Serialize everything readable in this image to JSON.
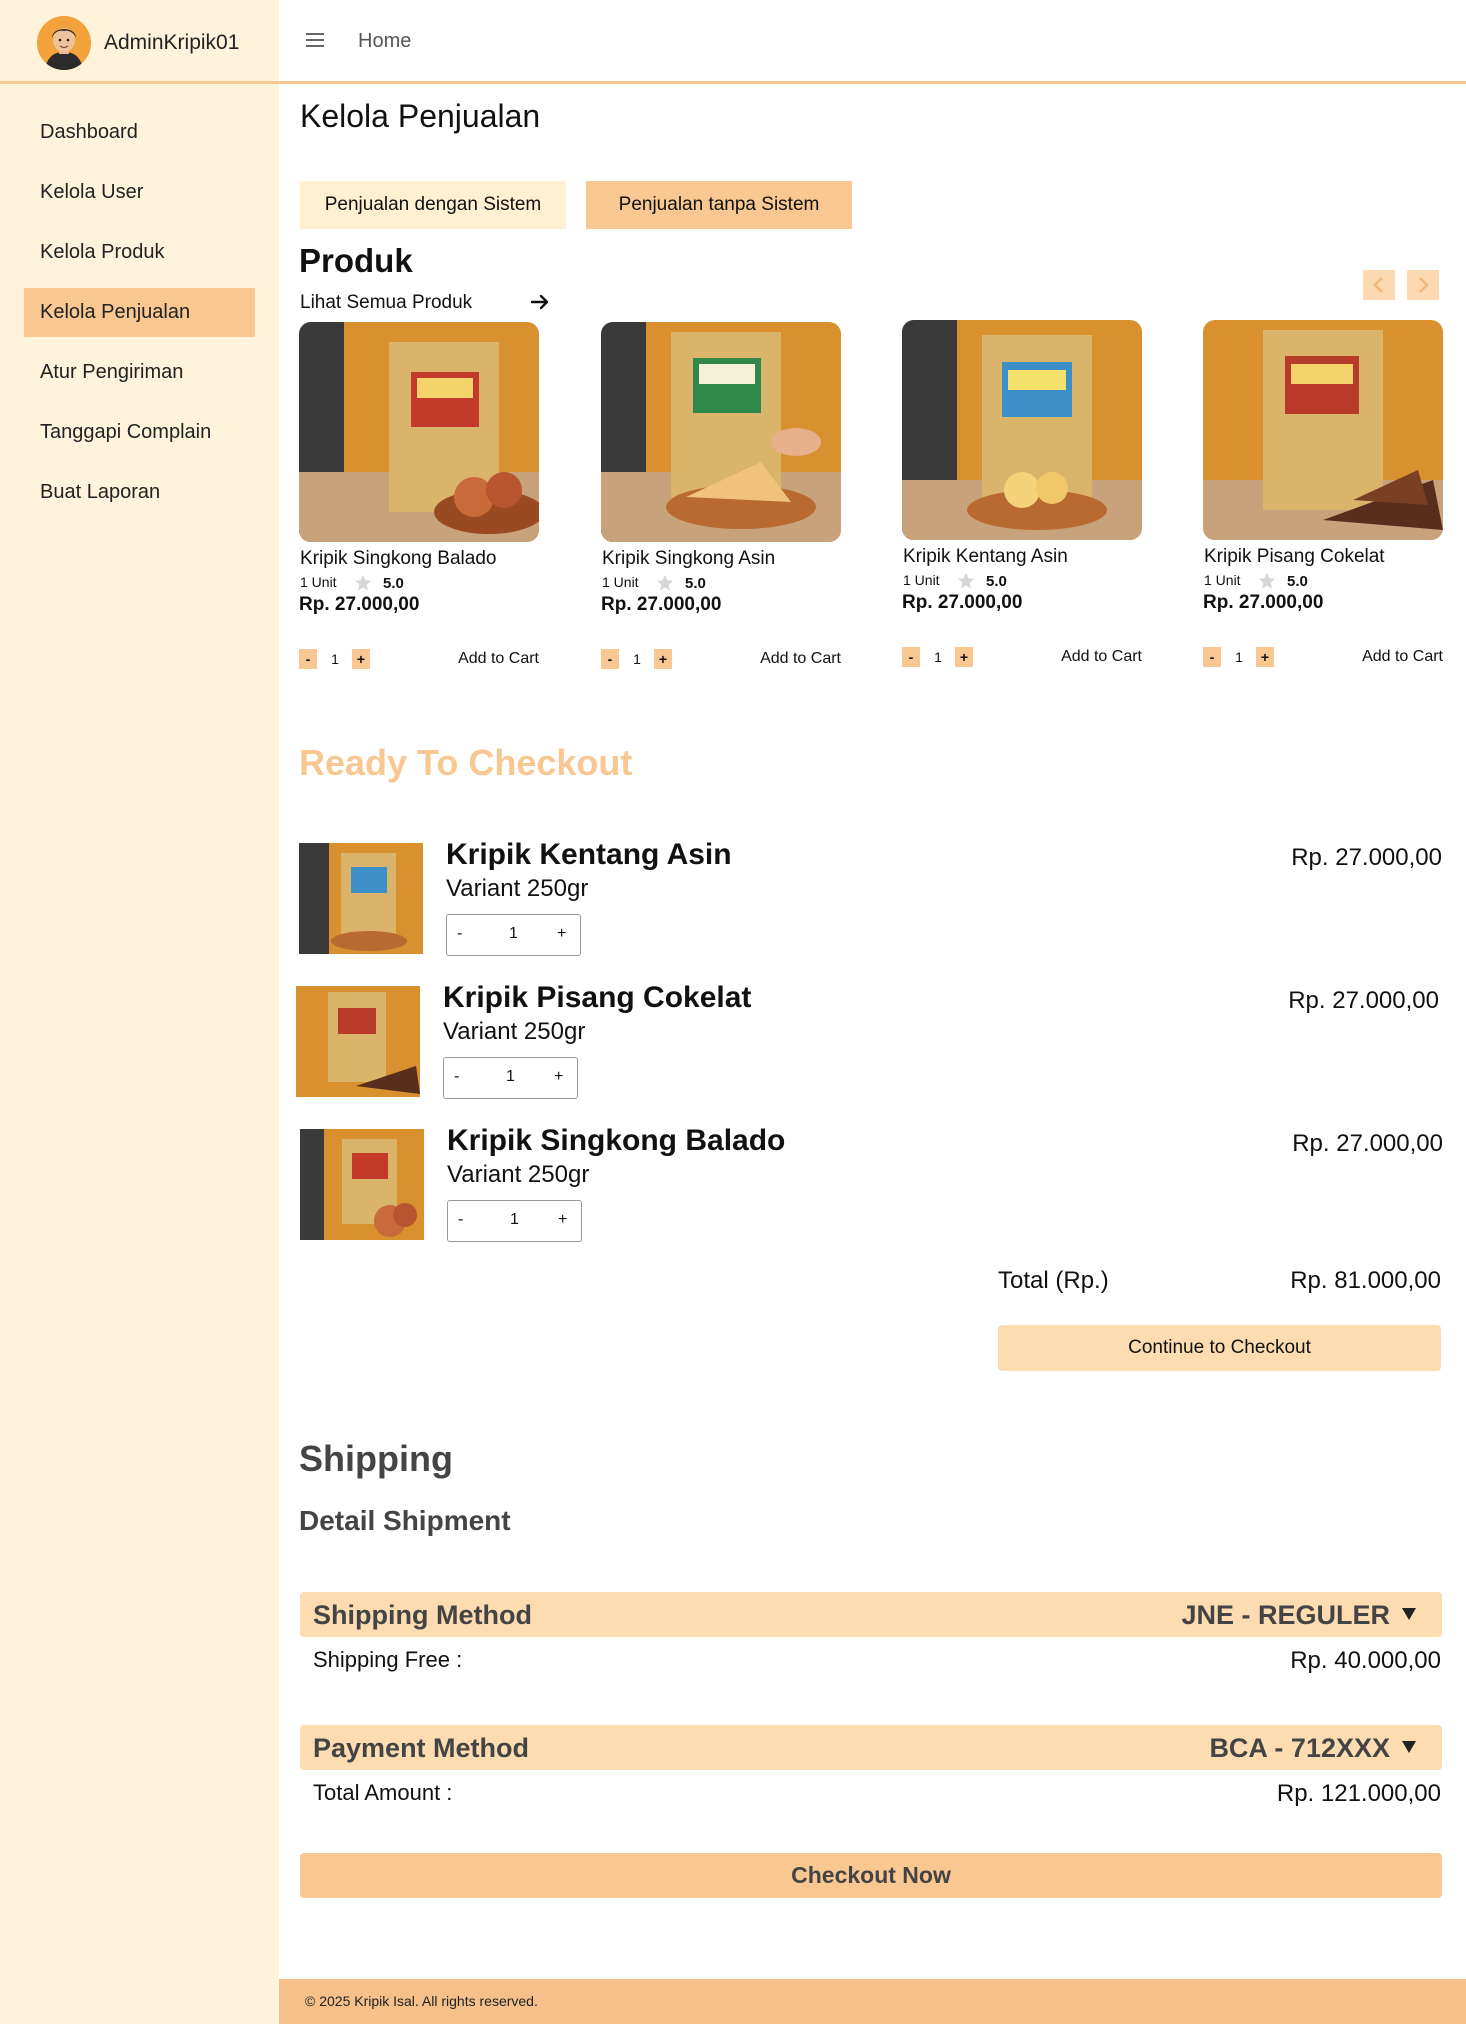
{
  "sidebar": {
    "username": "AdminKripik01",
    "items": [
      {
        "label": "Dashboard"
      },
      {
        "label": "Kelola User"
      },
      {
        "label": "Kelola Produk"
      },
      {
        "label": "Kelola Penjualan",
        "active": true
      },
      {
        "label": "Atur Pengiriman"
      },
      {
        "label": "Tanggapi Complain"
      },
      {
        "label": "Buat Laporan"
      }
    ]
  },
  "header": {
    "breadcrumb": "Home"
  },
  "page_title": "Kelola Penjualan",
  "tabs": [
    {
      "label": "Penjualan dengan Sistem"
    },
    {
      "label": "Penjualan tanpa Sistem",
      "active": true
    }
  ],
  "products_section": {
    "title": "Produk",
    "view_all": "Lihat Semua Produk",
    "items": [
      {
        "name": "Kripik  Singkong Balado",
        "unit": "1 Unit",
        "rating": "5.0",
        "price": "Rp. 27.000,00",
        "qty": "1",
        "add_label": "Add to Cart",
        "minus": "-",
        "plus": "+"
      },
      {
        "name": "Kripik  Singkong Asin",
        "unit": "1 Unit",
        "rating": "5.0",
        "price": "Rp. 27.000,00",
        "qty": "1",
        "add_label": "Add to Cart",
        "minus": "-",
        "plus": "+"
      },
      {
        "name": "Kripik  Kentang Asin",
        "unit": "1 Unit",
        "rating": "5.0",
        "price": "Rp. 27.000,00",
        "qty": "1",
        "add_label": "Add to Cart",
        "minus": "-",
        "plus": "+"
      },
      {
        "name": "Kripik  Pisang Cokelat",
        "unit": "1 Unit",
        "rating": "5.0",
        "price": "Rp. 27.000,00",
        "qty": "1",
        "add_label": "Add to Cart",
        "minus": "-",
        "plus": "+"
      }
    ]
  },
  "checkout": {
    "title": "Ready To Checkout",
    "items": [
      {
        "name": "Kripik  Kentang Asin",
        "variant": "Variant 250gr",
        "qty": "1",
        "price": "Rp. 27.000,00",
        "minus": "-",
        "plus": "+"
      },
      {
        "name": "Kripik Pisang Cokelat",
        "variant": "Variant 250gr",
        "qty": "1",
        "price": "Rp. 27.000,00",
        "minus": "-",
        "plus": "+"
      },
      {
        "name": "Kripik Singkong Balado",
        "variant": "Variant 250gr",
        "qty": "1",
        "price": "Rp. 27.000,00",
        "minus": "-",
        "plus": "+"
      }
    ],
    "total_label": "Total (Rp.)",
    "total_value": "Rp. 81.000,00",
    "continue_label": "Continue to Checkout"
  },
  "shipping": {
    "title": "Shipping",
    "subtitle": "Detail Shipment",
    "method_label": "Shipping Method",
    "method_value": "JNE - REGULER",
    "fee_label": "Shipping Free :",
    "fee_value": "Rp. 40.000,00",
    "payment_label": "Payment Method",
    "payment_value": "BCA - 712XXX",
    "amount_label": "Total Amount :",
    "amount_value": "Rp. 121.000,00",
    "checkout_now": "Checkout Now"
  },
  "footer": {
    "text": "© 2025 Kripik Isal. All rights reserved."
  },
  "colors": {
    "accent": "#f8c792",
    "sidebar_bg": "#fff3dc",
    "heading_accent": "#f8c792"
  },
  "icons": [
    "avatar",
    "hamburger-icon",
    "arrow-right-icon",
    "chevron-left-icon",
    "chevron-right-icon",
    "star-icon",
    "caret-down-icon"
  ]
}
